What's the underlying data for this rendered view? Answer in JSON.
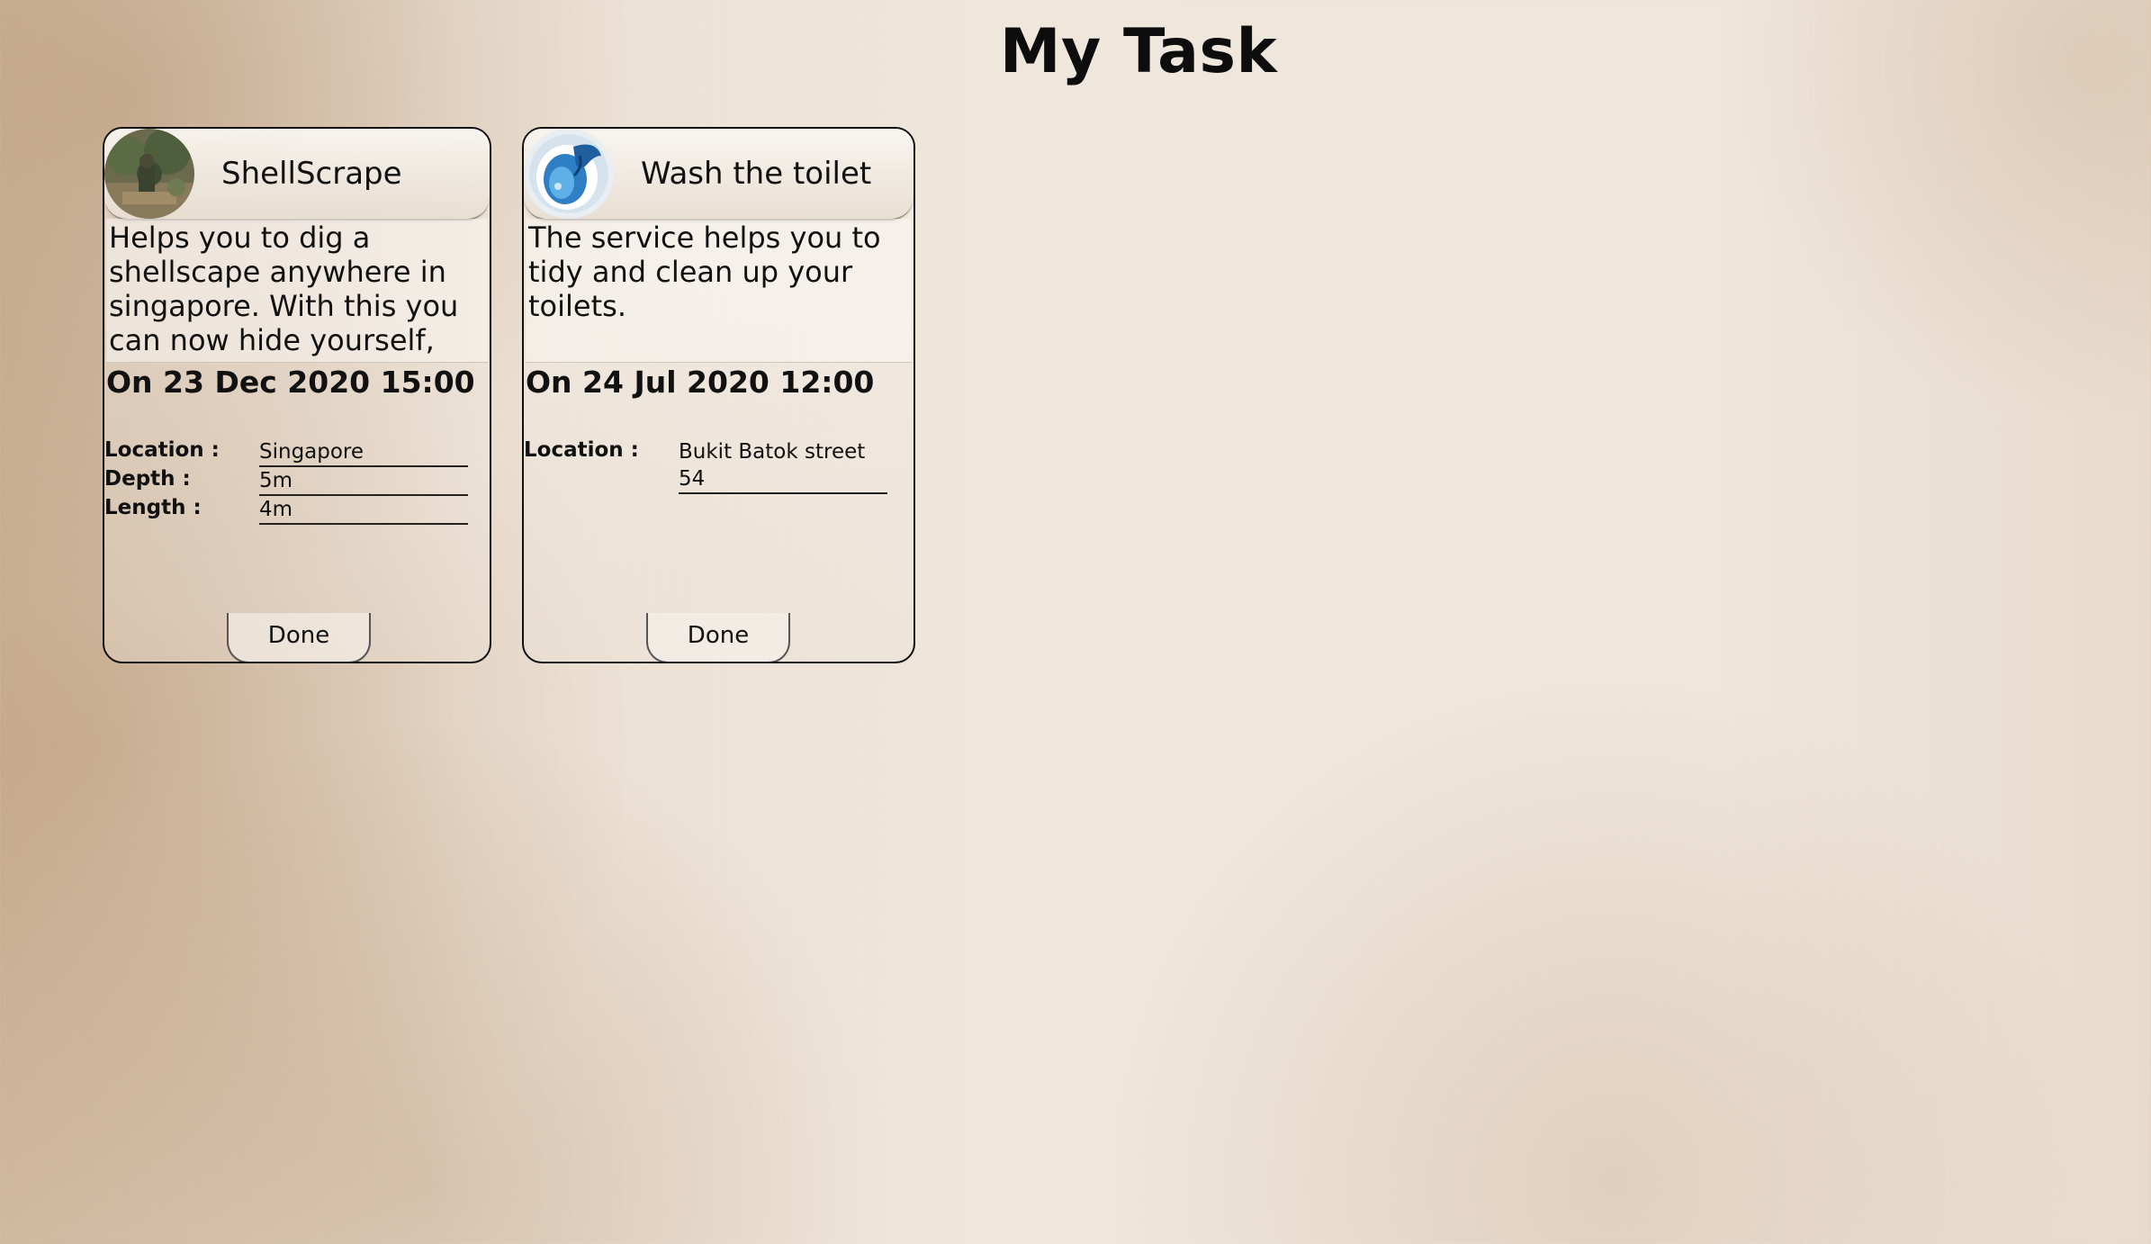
{
  "page": {
    "title": "My Task"
  },
  "tasks": [
    {
      "title": "ShellScrape",
      "description": "Helps you to dig a shellscape anywhere in singapore. With this you can now hide yourself,",
      "date": "On 23 Dec 2020 15:00",
      "details": [
        {
          "label": "Location :",
          "value": "Singapore"
        },
        {
          "label": "Depth :",
          "value": "5m"
        },
        {
          "label": "Length :",
          "value": "4m"
        }
      ],
      "done_label": "Done"
    },
    {
      "title": "Wash the toilet",
      "description": "The service helps you to tidy and clean up your toilets.",
      "date": "On 24 Jul 2020 12:00",
      "details": [
        {
          "label": "Location :",
          "value": "Bukit Batok street 54"
        }
      ],
      "done_label": "Done"
    }
  ]
}
